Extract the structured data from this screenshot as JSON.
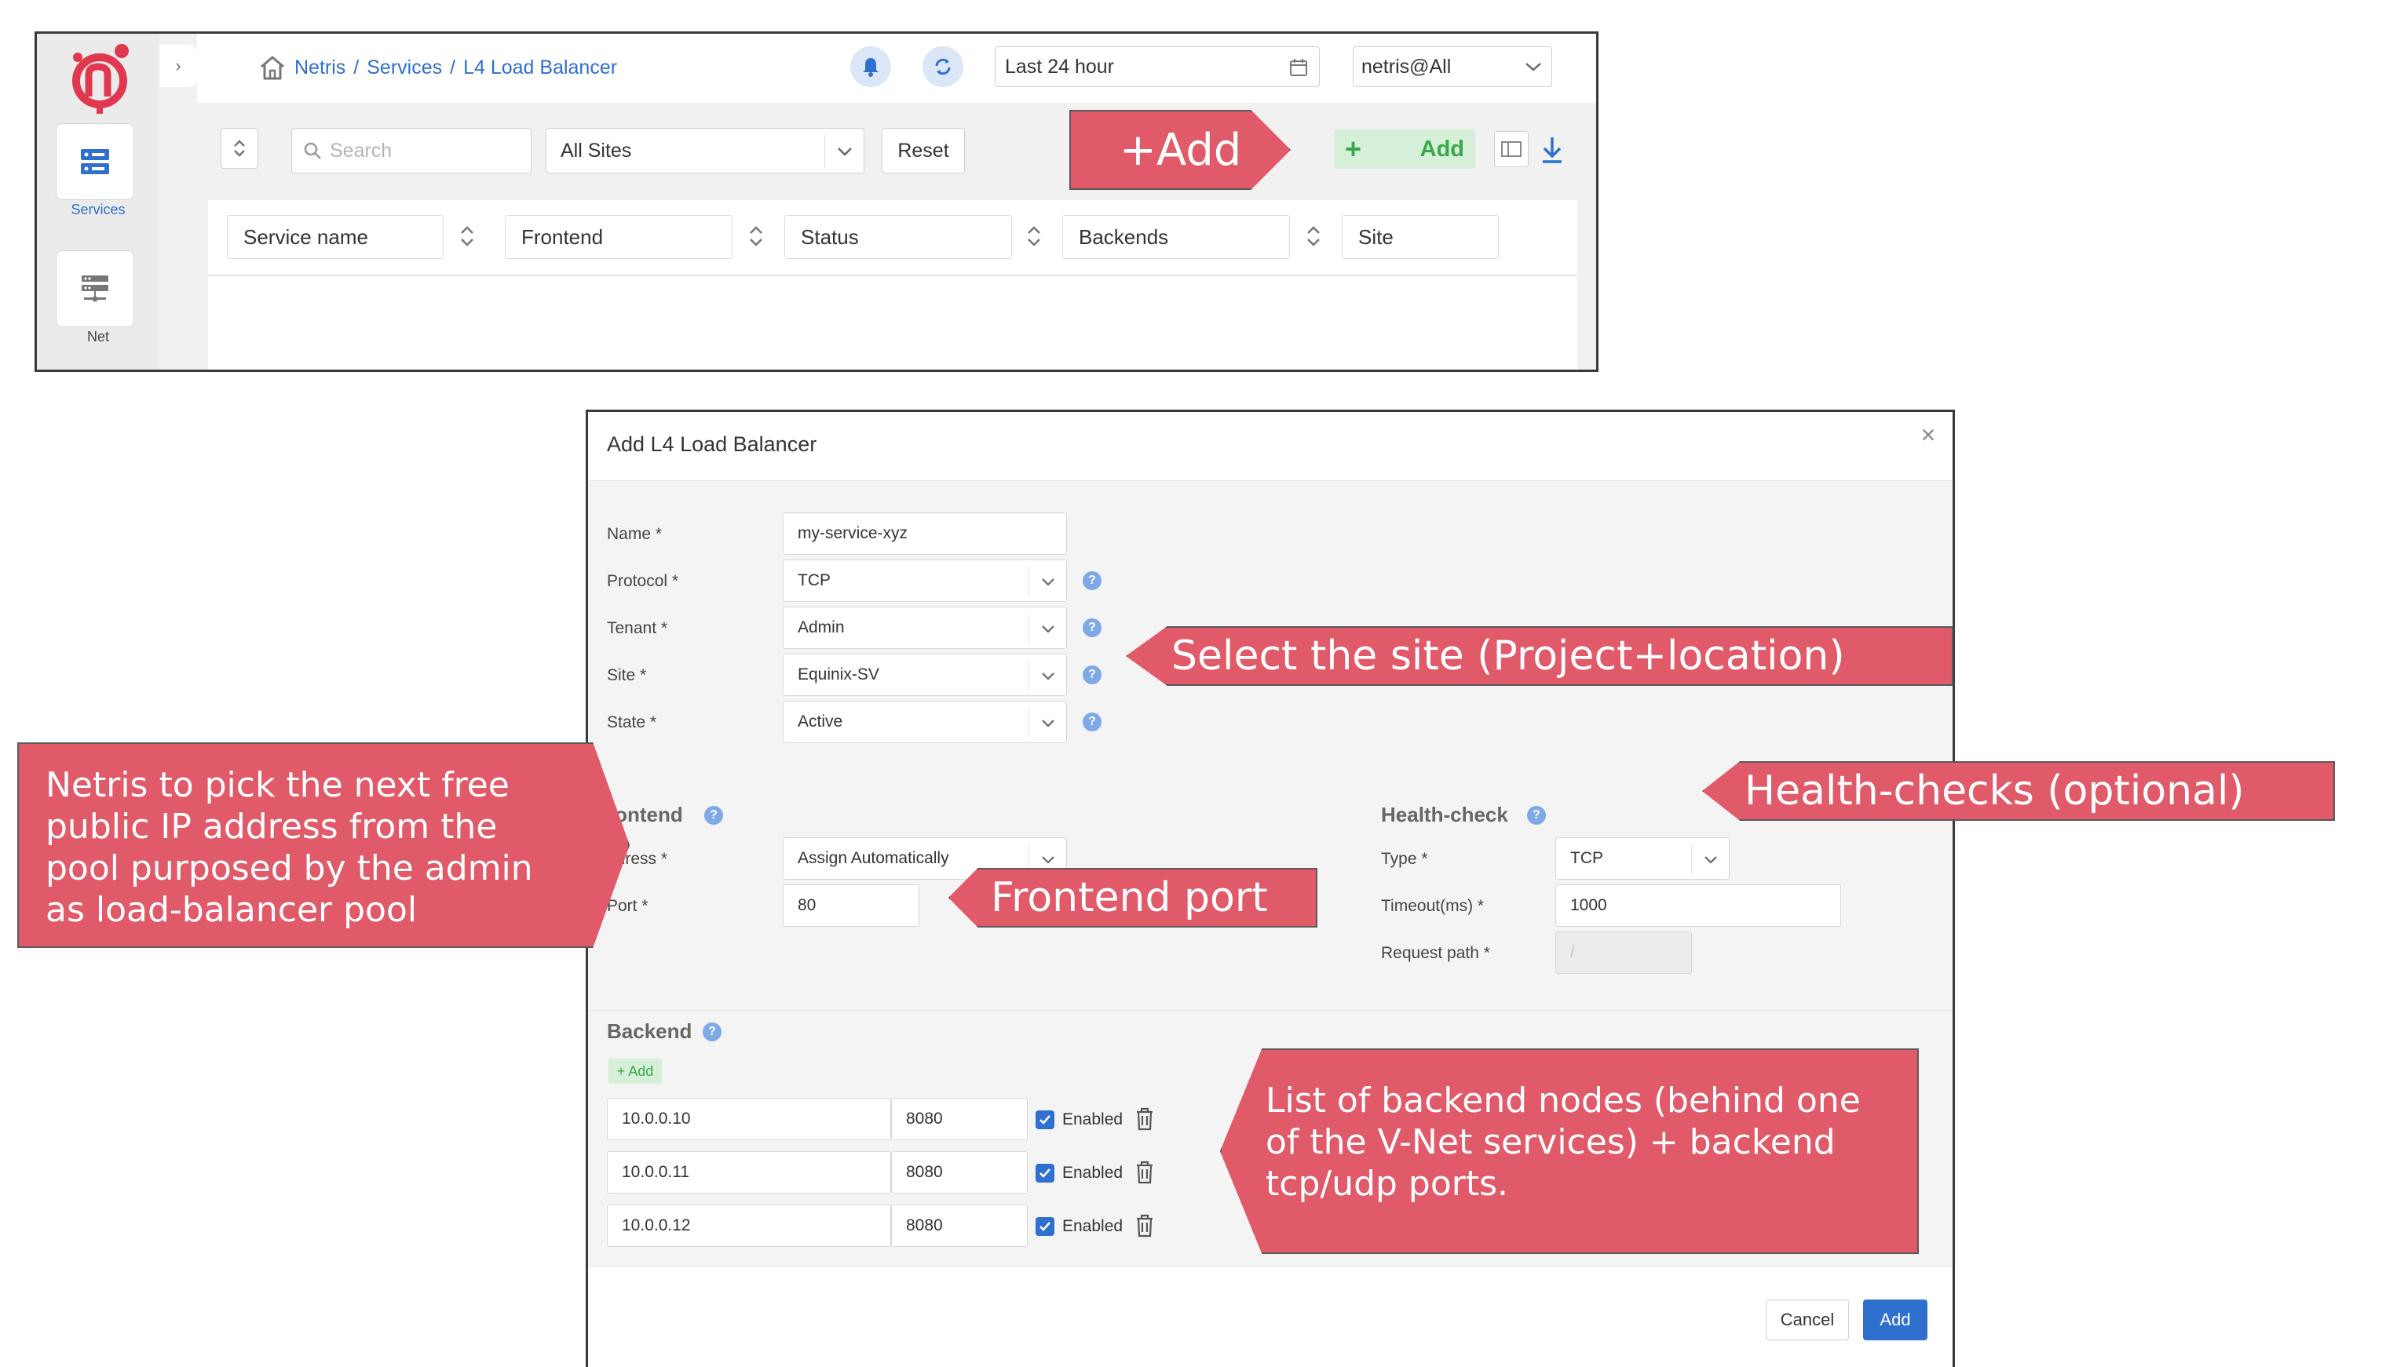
{
  "top_screen": {
    "nav": {
      "services_label": "Services",
      "net_label": "Net"
    },
    "breadcrumb": {
      "home_icon": "home-icon",
      "netris": "Netris",
      "sep1": "/",
      "services": "Services",
      "sep2": "/",
      "current": "L4 Load Balancer"
    },
    "time_range": "Last 24 hour",
    "account": "netris@All",
    "toolbar": {
      "search_placeholder": "Search",
      "site_filter": "All Sites",
      "reset_label": "Reset",
      "add_label": "Add",
      "plus_glyph": "+"
    },
    "table": {
      "columns": [
        "Service name",
        "Frontend",
        "Status",
        "Backends",
        "Site"
      ]
    }
  },
  "modal": {
    "title": "Add L4 Load Balancer",
    "close_glyph": "×",
    "help_glyph": "?",
    "fields": {
      "name": {
        "label": "Name *",
        "value": "my-service-xyz"
      },
      "protocol": {
        "label": "Protocol *",
        "value": "TCP"
      },
      "tenant": {
        "label": "Tenant *",
        "value": "Admin"
      },
      "site": {
        "label": "Site *",
        "value": "Equinix-SV"
      },
      "state": {
        "label": "State *",
        "value": "Active"
      }
    },
    "frontend": {
      "title": "rontend",
      "address_label": "ddress *",
      "address_value": "Assign Automatically",
      "port_label": "Port *",
      "port_value": "80"
    },
    "health_check": {
      "title": "Health-check",
      "type_label": "Type *",
      "type_value": "TCP",
      "timeout_label": "Timeout(ms) *",
      "timeout_value": "1000",
      "path_label": "Request path *",
      "path_placeholder": "/"
    },
    "backend": {
      "title": "Backend",
      "add_label": "+ Add",
      "rows": [
        {
          "ip": "10.0.0.10",
          "port": "8080",
          "enabled_label": "Enabled"
        },
        {
          "ip": "10.0.0.11",
          "port": "8080",
          "enabled_label": "Enabled"
        },
        {
          "ip": "10.0.0.12",
          "port": "8080",
          "enabled_label": "Enabled"
        }
      ]
    },
    "footer": {
      "cancel_label": "Cancel",
      "add_label": "Add"
    }
  },
  "callouts": {
    "add": "+Add",
    "site": "Select the site (Project+location)",
    "health": "Health-checks (optional)",
    "frontend_port": "Frontend port",
    "pool": "Netris to pick the next free public IP address from the pool purposed by the admin as load-balancer pool",
    "backends": "List of backend nodes (behind one of the V-Net services) + backend tcp/udp ports."
  },
  "colors": {
    "callout": "#e05a6a",
    "brand_red": "#e0394f",
    "link_blue": "#2f6fce",
    "add_green": "#3aa84a",
    "add_green_bg": "#d6efd8"
  }
}
